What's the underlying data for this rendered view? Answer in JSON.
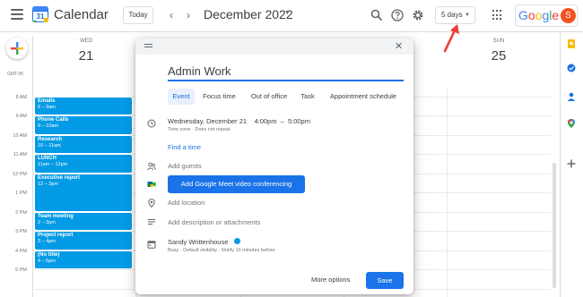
{
  "header": {
    "app_name": "Calendar",
    "logo_day": "31",
    "today_label": "Today",
    "prev_glyph": "‹",
    "next_glyph": "›",
    "month_title": "December 2022",
    "month_caret": "▼",
    "view_label": "5 days",
    "view_caret": "▼",
    "google_letters": [
      "G",
      "o",
      "o",
      "g",
      "l",
      "e"
    ],
    "google_colors": [
      "#4285f4",
      "#ea4335",
      "#fbbc04",
      "#4285f4",
      "#34a853",
      "#ea4335"
    ],
    "avatar_letter": "S",
    "icons": [
      "menu-icon",
      "search-icon",
      "help-icon",
      "gear-icon",
      "apps-grid-icon"
    ]
  },
  "days": [
    {
      "dow": "WED",
      "num": "21"
    },
    {
      "dow": "SUN",
      "num": "25"
    }
  ],
  "timezone_label": "GMT-05",
  "hours": [
    "8 AM",
    "9 AM",
    "10 AM",
    "11 AM",
    "12 PM",
    "1 PM",
    "2 PM",
    "3 PM",
    "4 PM",
    "5 PM"
  ],
  "events": [
    {
      "title": "Emails",
      "time": "8 – 9am"
    },
    {
      "title": "Phone Calls",
      "time": "9 – 10am"
    },
    {
      "title": "Research",
      "time": "10 – 11am"
    },
    {
      "title": "LUNCH",
      "time": "11am – 12pm"
    },
    {
      "title": "Executive report",
      "time": "12 – 2pm"
    },
    {
      "title": "Team meeting",
      "time": "2 – 3pm"
    },
    {
      "title": "Project report",
      "time": "3 – 4pm"
    },
    {
      "title": "(No title)",
      "time": "4 – 5pm"
    }
  ],
  "dialog": {
    "close_glyph": "✕",
    "title_value": "Admin Work",
    "tabs": [
      "Event",
      "Focus time",
      "Out of office",
      "Task",
      "Appointment schedule"
    ],
    "active_tab": "Event",
    "when": "Wednesday, December 21    4:00pm  –  5:00pm",
    "when_sub": "Time zone · Does not repeat",
    "find_time": "Find a time",
    "add_guests": "Add guests",
    "meet_button": "Add Google Meet video conferencing",
    "add_location": "Add location",
    "add_description": "Add description or attachments",
    "owner_name": "Sandy Writtenhouse",
    "owner_sub": "Busy · Default visibility · Notify 10 minutes before",
    "more_options": "More options",
    "save": "Save"
  },
  "colors": {
    "event_blue": "#039be5",
    "accent": "#1a73e8",
    "arrow_red": "#ea4335"
  }
}
